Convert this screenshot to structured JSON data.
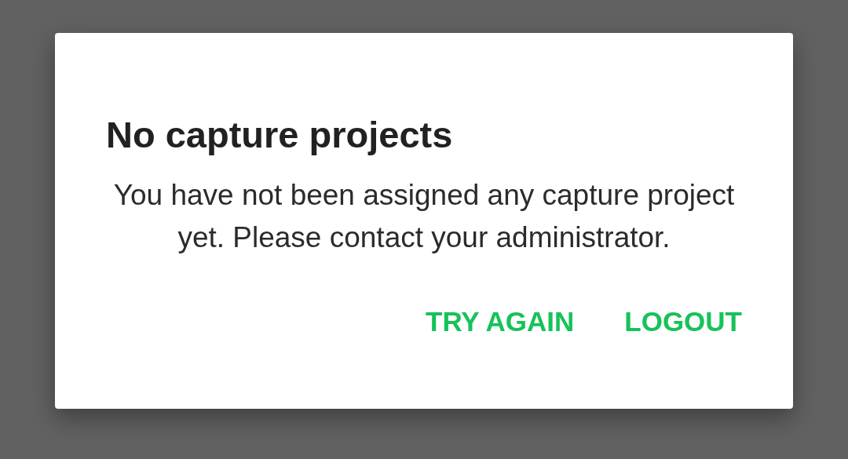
{
  "dialog": {
    "title": "No capture projects",
    "message": "You have not been assigned any capture project yet. Please contact your administrator.",
    "buttons": [
      {
        "label": "TRY AGAIN",
        "kind": "text"
      },
      {
        "label": "LOGOUT",
        "kind": "text"
      }
    ]
  }
}
